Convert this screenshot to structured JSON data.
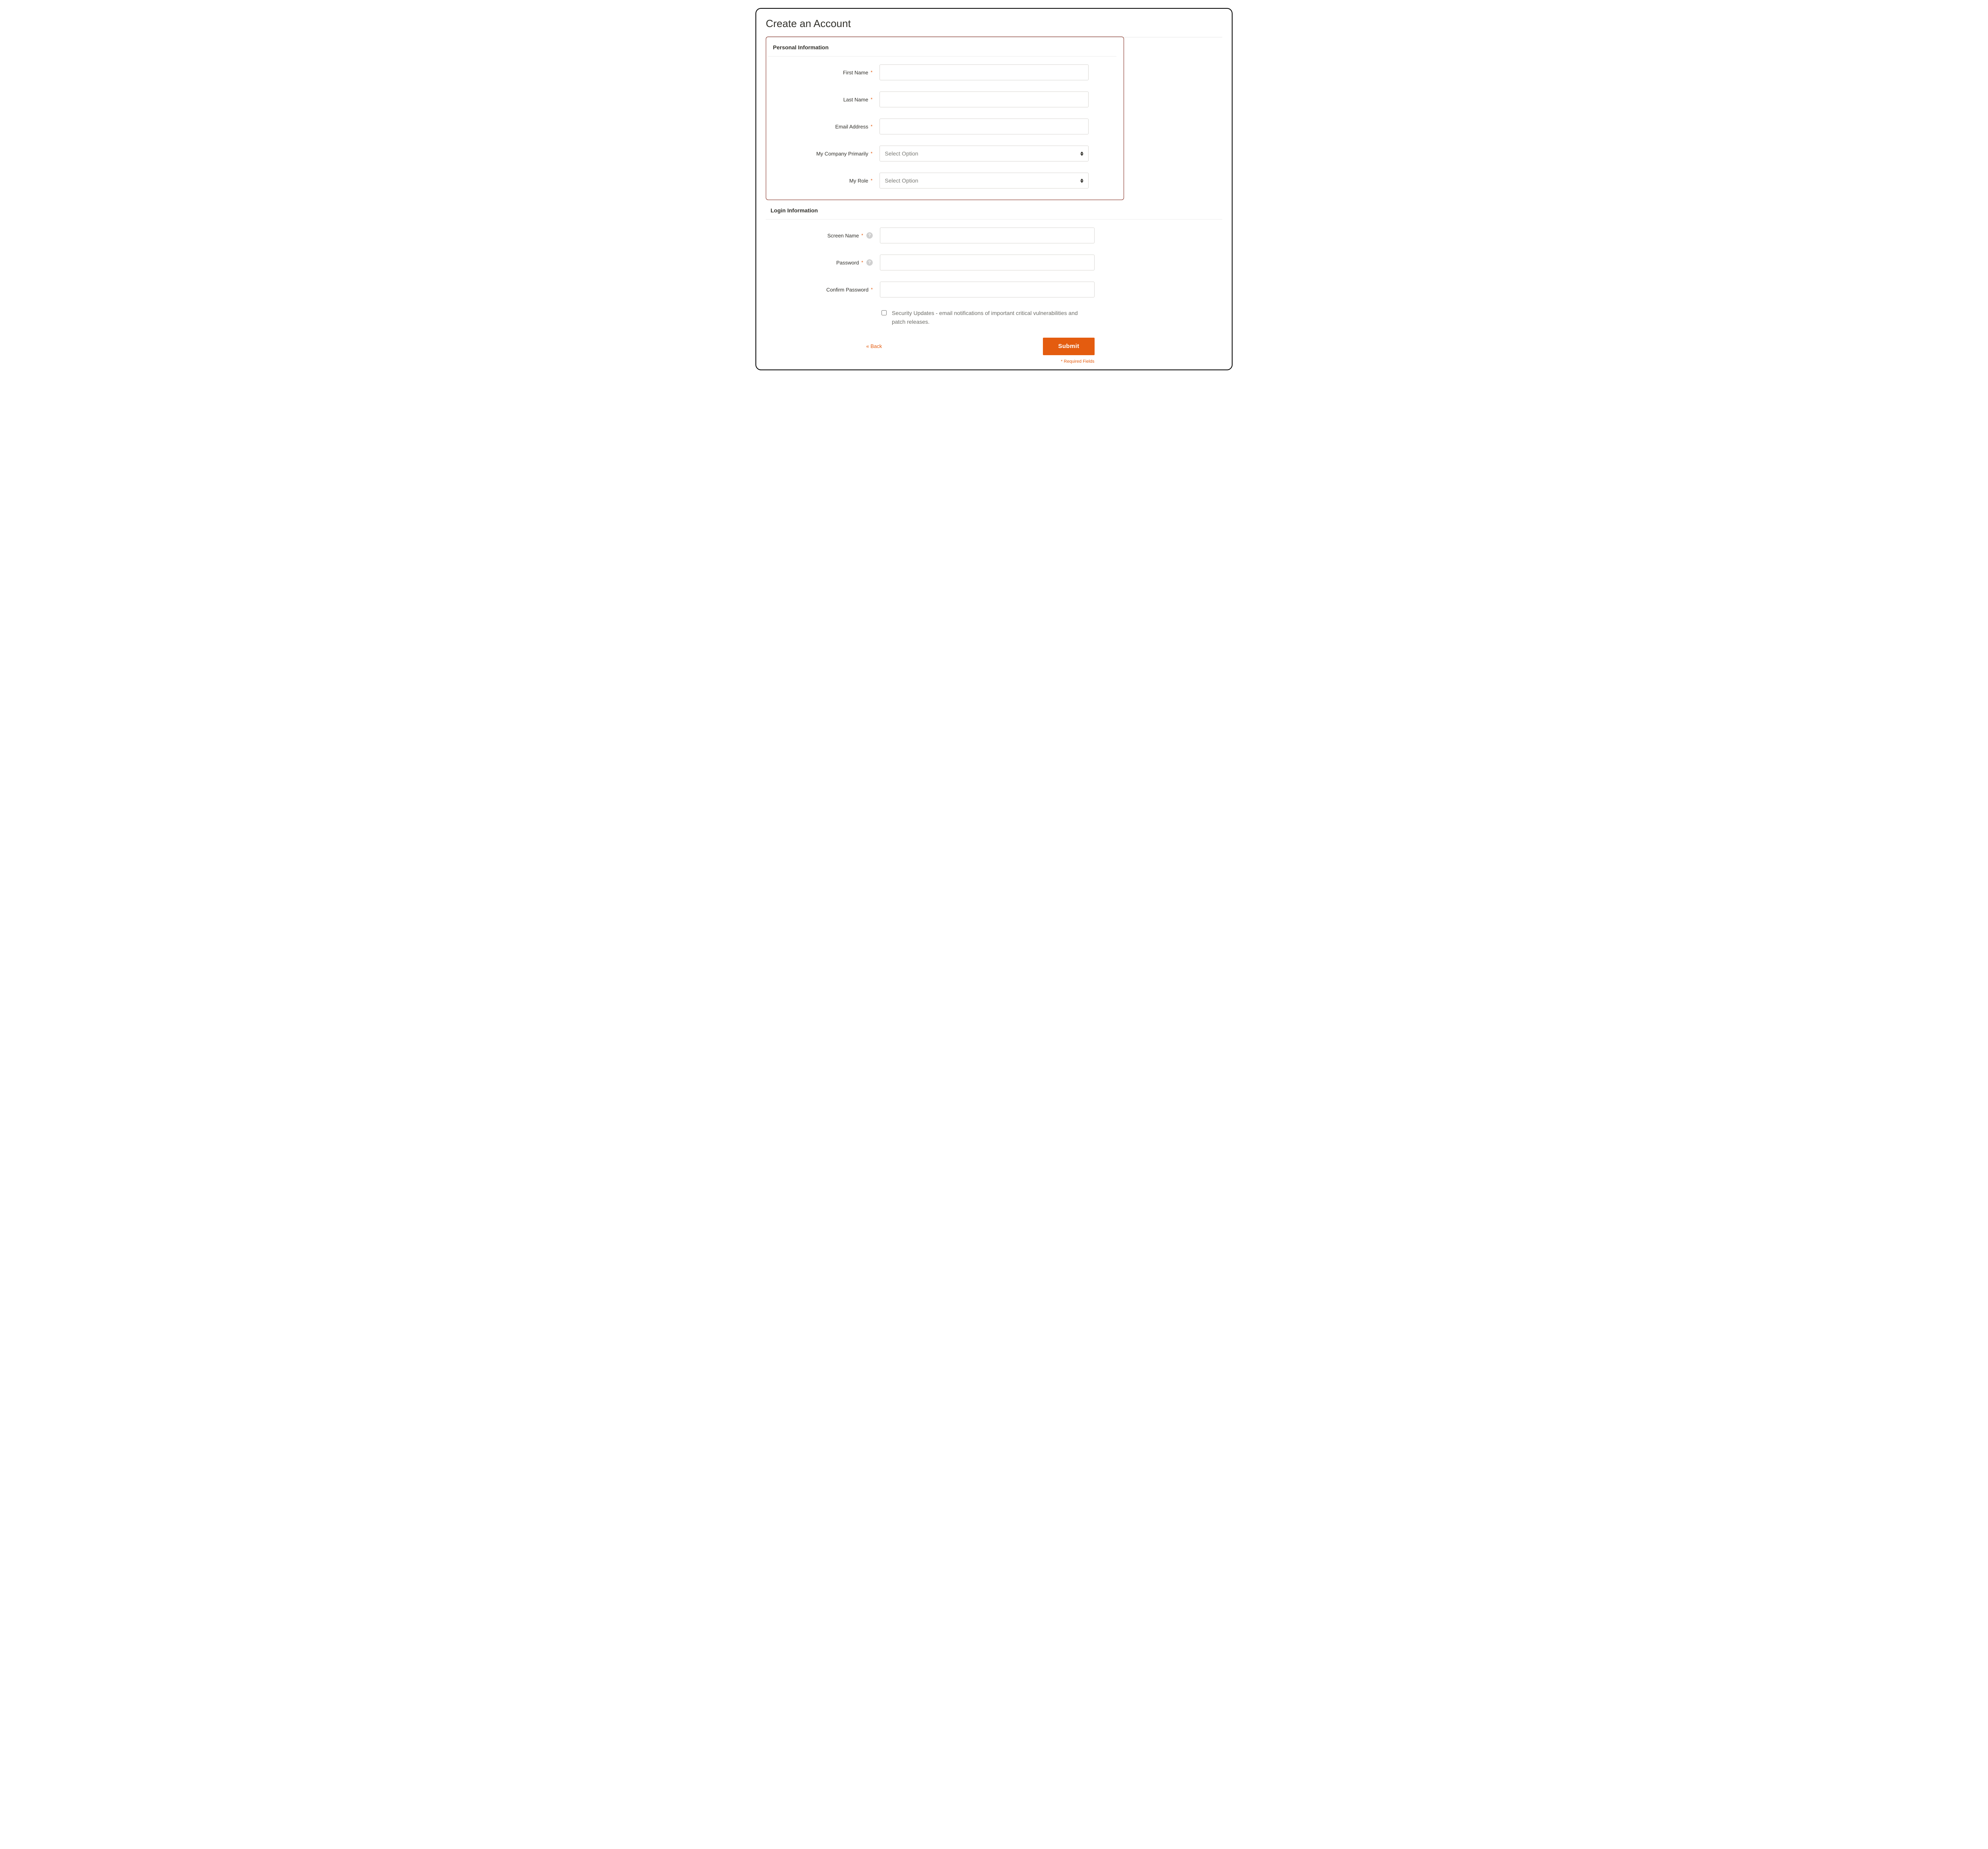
{
  "page": {
    "title": "Create an Account",
    "back_link": "« Back",
    "submit_button": "Submit",
    "required_note": "* Required Fields"
  },
  "select_placeholder": "Select Option",
  "sections": {
    "personal": {
      "title": "Personal Information",
      "fields": {
        "first_name": "First Name",
        "last_name": "Last Name",
        "email": "Email Address",
        "company": "My Company Primarily",
        "role": "My Role"
      }
    },
    "login": {
      "title": "Login Information",
      "fields": {
        "screen_name": "Screen Name",
        "password": "Password",
        "confirm_password": "Confirm Password"
      },
      "checkbox_label": "Security Updates - email notifications of important critical vulnerabilities and patch releases."
    }
  },
  "help_icon_text": "?"
}
